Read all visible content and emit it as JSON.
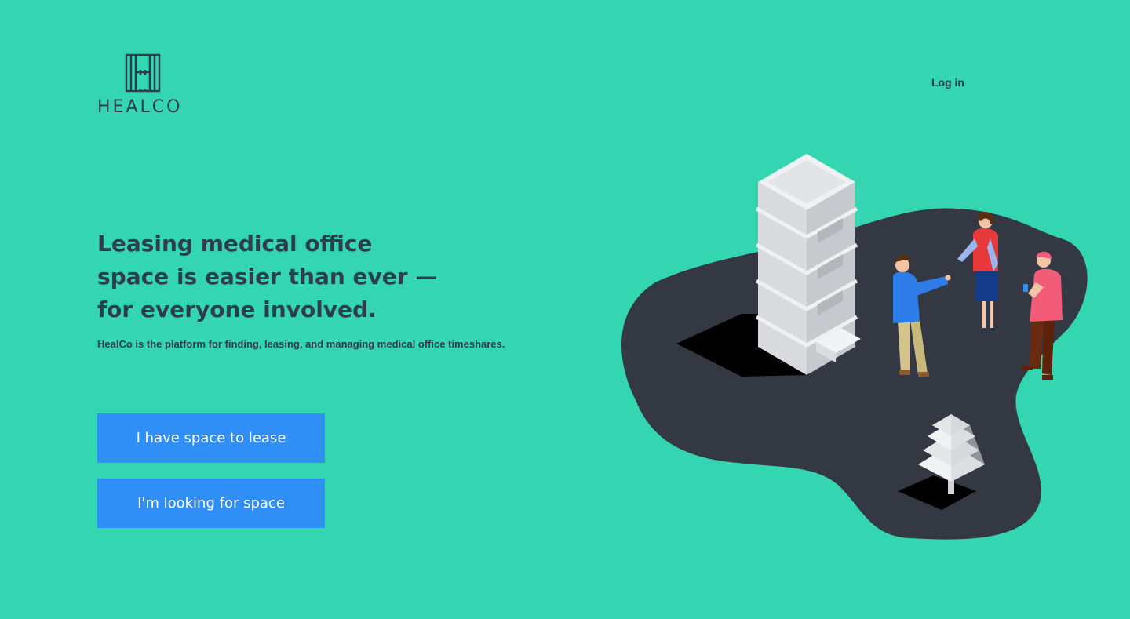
{
  "brand": {
    "name": "HEALCO",
    "logo_icon": "healco-h-monogram",
    "color": "#2e3d4c"
  },
  "nav": {
    "login_label": "Log in"
  },
  "hero": {
    "headline_lines": [
      "Leasing medical office",
      "space is easier than ever —",
      "for everyone involved."
    ],
    "subheadline": "HealCo is the platform for finding, leasing, and managing medical office timeshares."
  },
  "cta": {
    "lease_label": "I have space to lease",
    "looking_label": "I'm looking for space"
  },
  "colors": {
    "background": "#33d6b1",
    "text": "#2e3d4c",
    "button": "#2f8ff7",
    "ground": "#343843"
  },
  "illustration": {
    "icon": "isometric-office-building-people-illustration"
  }
}
